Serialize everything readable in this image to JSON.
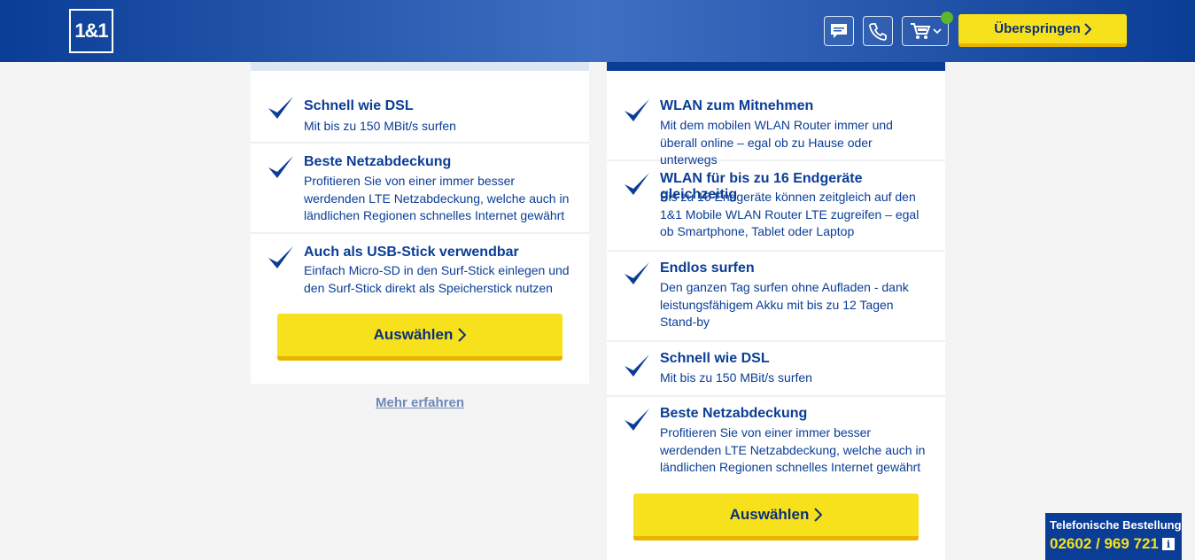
{
  "header": {
    "logo_text": "1&1",
    "skip_label": "Überspringen",
    "icons": [
      "chat-icon",
      "phone-icon",
      "cart-icon"
    ],
    "cart_status_color": "#5bb630",
    "accent_yellow": "#f7e11c",
    "brand_blue": "#0a3d96"
  },
  "left_card": {
    "features": [
      {
        "title": "Schnell wie DSL",
        "desc": "Mit bis zu 150 MBit/s surfen"
      },
      {
        "title": "Beste Netzabdeckung",
        "desc": "Profitieren Sie von einer immer besser werdenden LTE Netzabdeckung, welche auch in ländlichen Regionen schnelles Internet gewährt"
      },
      {
        "title": "Auch als USB-Stick verwendbar",
        "desc": "Einfach Micro-SD in den Surf-Stick einlegen und den Surf-Stick direkt als Speicherstick nutzen"
      }
    ],
    "select_label": "Auswählen",
    "more_link": "Mehr erfahren"
  },
  "right_card": {
    "features": [
      {
        "title": "WLAN zum Mitnehmen",
        "desc": "Mit dem mobilen WLAN Router immer und überall online – egal ob zu Hause oder unterwegs"
      },
      {
        "title": "WLAN für bis zu 16 Endgeräte gleichzeitig",
        "desc": "Bis zu 16 Endgeräte können zeitgleich auf den 1&1 Mobile WLAN Router LTE zugreifen – egal ob Smartphone, Tablet oder Laptop"
      },
      {
        "title": "Endlos surfen",
        "desc": "Den ganzen Tag surfen ohne Aufladen - dank leistungsfähigem Akku mit bis zu 12 Tagen Stand-by"
      },
      {
        "title": "Schnell wie DSL",
        "desc": "Mit bis zu 150 MBit/s surfen"
      },
      {
        "title": "Beste Netzabdeckung",
        "desc": "Profitieren Sie von einer immer besser werdenden LTE Netzabdeckung, welche auch in ländlichen Regionen schnelles Internet gewährt"
      }
    ],
    "select_label": "Auswählen"
  },
  "phone_order": {
    "label": "Telefonische Bestellung",
    "number": "02602 / 969 721",
    "info_glyph": "i"
  }
}
